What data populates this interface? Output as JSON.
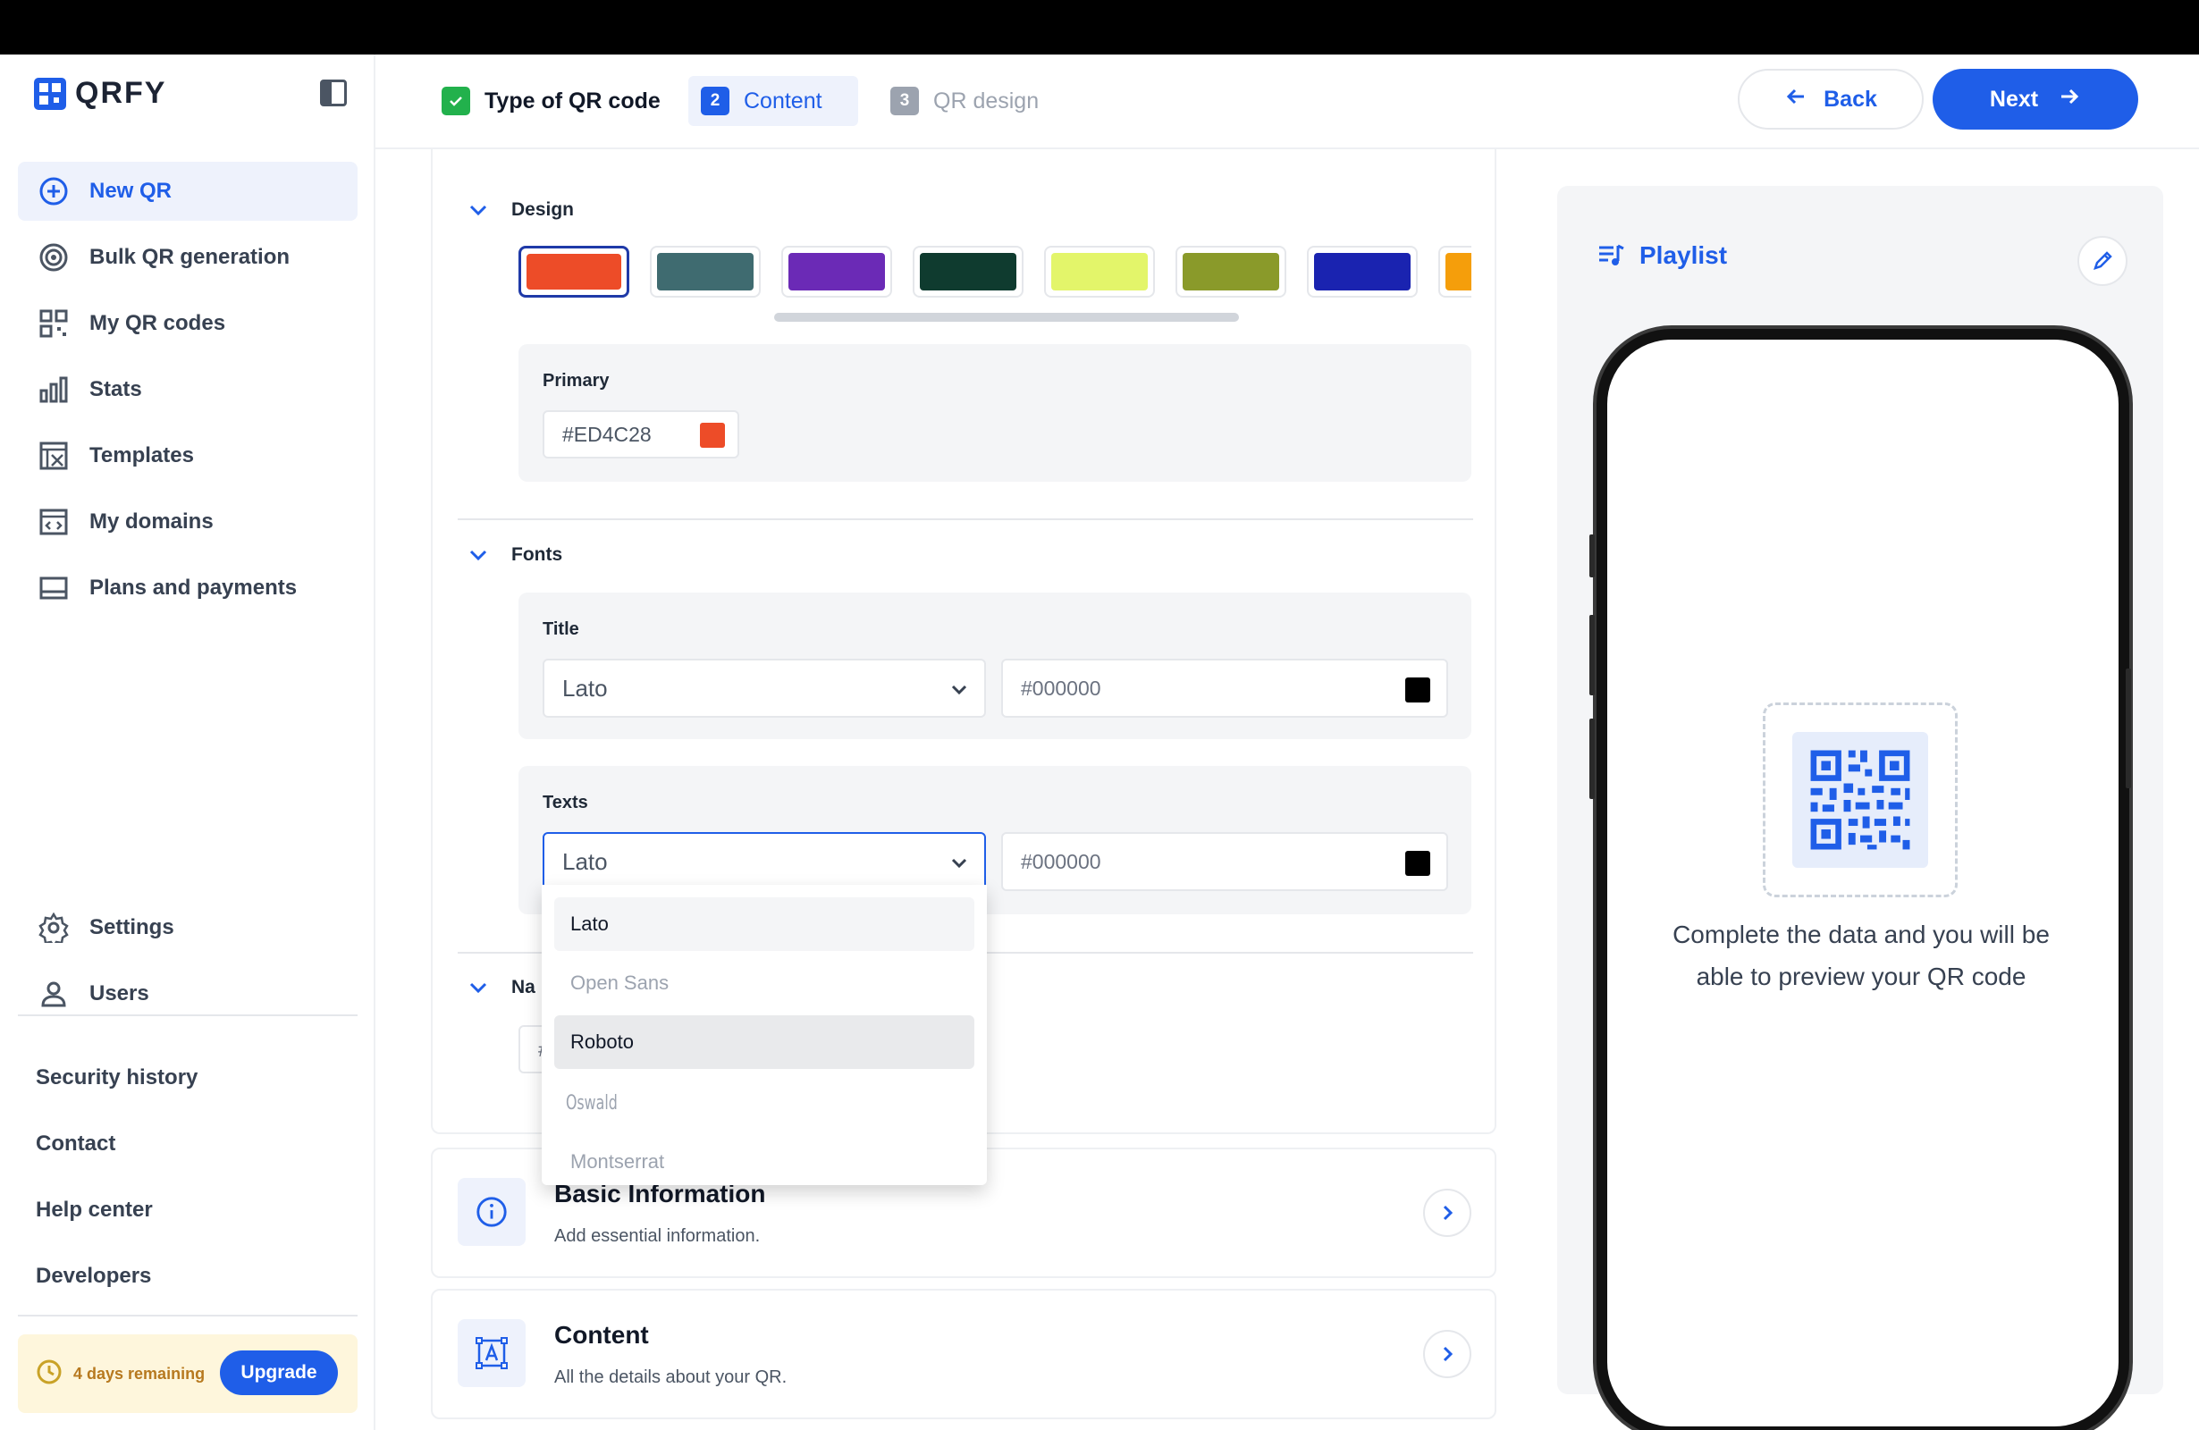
{
  "app": {
    "logo_text": "QRFY"
  },
  "sidebar": {
    "items": [
      {
        "label": "New QR",
        "icon": "new-qr-icon",
        "active": true
      },
      {
        "label": "Bulk QR generation",
        "icon": "bulk-icon"
      },
      {
        "label": "My QR codes",
        "icon": "qr-codes-icon"
      },
      {
        "label": "Stats",
        "icon": "stats-icon"
      },
      {
        "label": "Templates",
        "icon": "templates-icon"
      },
      {
        "label": "My domains",
        "icon": "domains-icon"
      },
      {
        "label": "Plans and payments",
        "icon": "payments-icon"
      }
    ],
    "bottom_items": [
      {
        "label": "Settings",
        "icon": "gear-icon"
      },
      {
        "label": "Users",
        "icon": "user-icon"
      }
    ],
    "links": [
      "Security history",
      "Contact",
      "Help center",
      "Developers"
    ],
    "trial": {
      "text": "4 days remaining",
      "upgrade_label": "Upgrade"
    }
  },
  "header": {
    "steps": [
      {
        "number": "✓",
        "label": "Type of QR code",
        "state": "done"
      },
      {
        "number": "2",
        "label": "Content",
        "state": "current"
      },
      {
        "number": "3",
        "label": "QR design",
        "state": "pending"
      }
    ],
    "back_label": "Back",
    "next_label": "Next"
  },
  "design": {
    "title": "Design",
    "palettes": [
      "#ED4C28",
      "#3F6B70",
      "#6B2AB6",
      "#0F3B2F",
      "#E3F56A",
      "#8A9A2A",
      "#1A23B0",
      "#F59E0B"
    ],
    "primary": {
      "label": "Primary",
      "value": "#ED4C28",
      "color": "#ED4C28"
    }
  },
  "fonts": {
    "title": "Fonts",
    "title_font": {
      "label": "Title",
      "font": "Lato",
      "color_value": "#000000",
      "color": "#000000"
    },
    "texts_font": {
      "label": "Texts",
      "font": "Lato",
      "color_value": "#000000",
      "color": "#000000"
    },
    "dropdown_options": [
      "Lato",
      "Open Sans",
      "Roboto",
      "Oswald",
      "Montserrat"
    ]
  },
  "nav_section": {
    "title_visible": "Na",
    "input_prefix": "#"
  },
  "accordions": [
    {
      "title": "Basic Information",
      "subtitle": "Add essential information."
    },
    {
      "title": "Content",
      "subtitle": "All the details about your QR."
    }
  ],
  "preview": {
    "title": "Playlist",
    "message": "Complete the data and you will be able to preview your QR code"
  }
}
